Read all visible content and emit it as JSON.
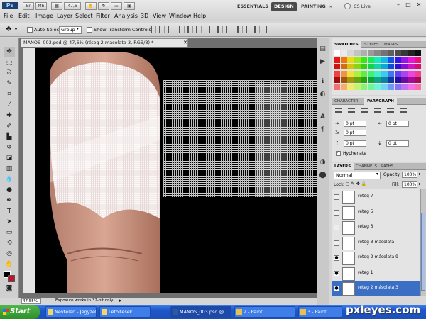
{
  "app": {
    "logo": "Ps",
    "zoom_select": "47,6"
  },
  "menu": [
    "File",
    "Edit",
    "Image",
    "Layer",
    "Select",
    "Filter",
    "Analysis",
    "3D",
    "View",
    "Window",
    "Help"
  ],
  "workspaces": {
    "essentials": "ESSENTIALS",
    "design": "DESIGN",
    "painting": "PAINTING",
    "more": "»",
    "cs_live": "CS Live"
  },
  "options": {
    "auto_select": "Auto-Select:",
    "group": "Group",
    "show_transform": "Show Transform Controls"
  },
  "document": {
    "tab_title": "MANOS_003.psd @ 47,6% (réteg 2 másolata 3, RGB/8) *",
    "zoom": "47,55%",
    "status": "Exposure works in 32-bit only"
  },
  "panels": {
    "swatches": {
      "tabs": [
        "SWATCHES",
        "STYLES",
        "MASKS"
      ]
    },
    "character": {
      "tabs": [
        "CHARACTER",
        "PARAGRAPH"
      ],
      "fields": [
        "0 pt",
        "0 pt",
        "0 pt",
        "0 pt",
        "0 pt"
      ],
      "hyphenate": "Hyphenate"
    },
    "layers": {
      "tabs": [
        "LAYERS",
        "CHANNELS",
        "PATHS"
      ],
      "blend_mode": "Normal",
      "opacity_label": "Opacity:",
      "opacity": "100%",
      "lock_label": "Lock:",
      "fill_label": "Fill:",
      "fill": "100%",
      "items": [
        {
          "name": "réteg 7",
          "visible": false,
          "selected": false
        },
        {
          "name": "réteg 5",
          "visible": false,
          "selected": false
        },
        {
          "name": "réteg 3",
          "visible": false,
          "selected": false
        },
        {
          "name": "réteg 3 másolata",
          "visible": false,
          "selected": false
        },
        {
          "name": "réteg 2 másolata 9",
          "visible": true,
          "selected": false
        },
        {
          "name": "réteg 1",
          "visible": true,
          "selected": false
        },
        {
          "name": "réteg 2 másolata 3",
          "visible": true,
          "selected": true
        }
      ]
    }
  },
  "taskbar": {
    "start": "Start",
    "items": [
      "Névtelen - Jegyzet...",
      "Letöltések",
      "MANOS_003.psd @...",
      "2 - Paint",
      "3 - Paint"
    ],
    "watermark": "pxleyes.com"
  },
  "colors": {
    "canvas": "#000000",
    "selection": "#3a6fc4",
    "taskbar": "#1d56c9"
  }
}
